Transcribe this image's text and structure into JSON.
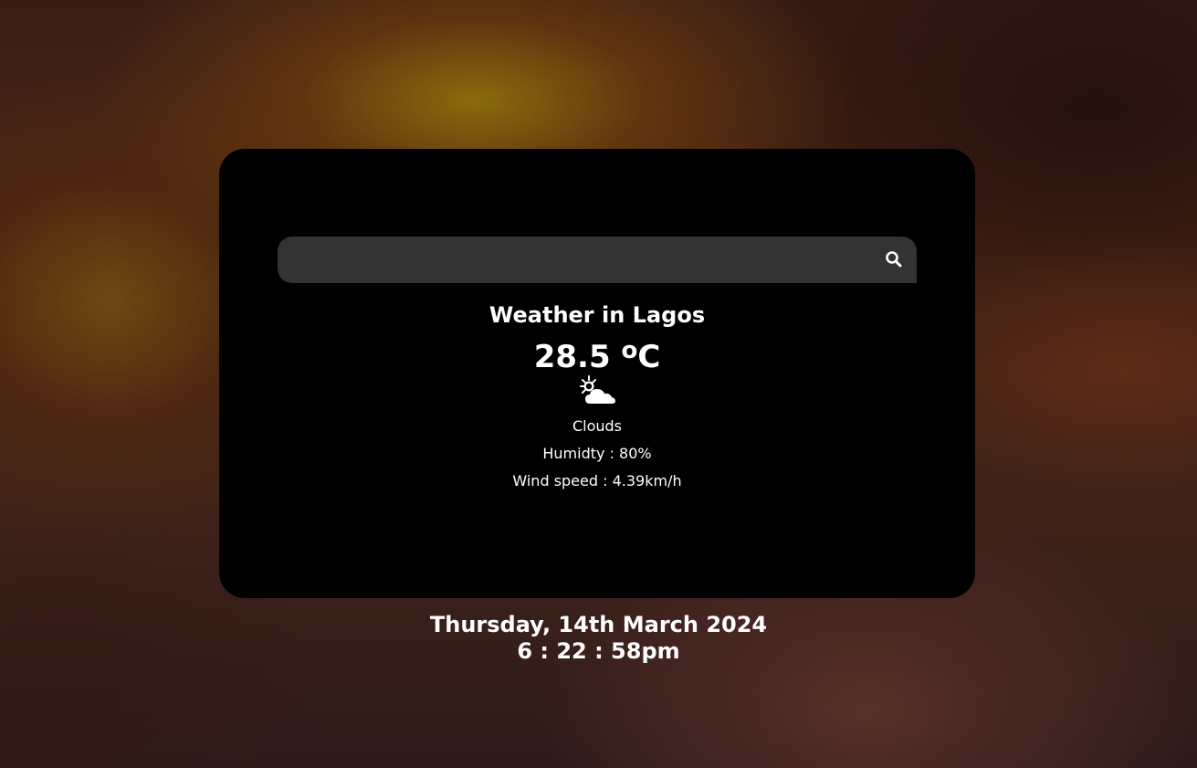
{
  "search": {
    "placeholder": "",
    "value": "",
    "icon": "search-icon"
  },
  "weather": {
    "title": "Weather in Lagos",
    "temperature": "28.5",
    "unit_prefix": "o",
    "unit_suffix": "C",
    "icon": "partly-cloudy-icon",
    "description": "Clouds",
    "humidity": "Humidty : 80%",
    "wind": "Wind speed : 4.39km/h"
  },
  "clock": {
    "date": "Thursday, 14th March 2024",
    "time": "6 : 22 : 58pm"
  },
  "colors": {
    "card": "#000000",
    "search_bg": "#333333",
    "text": "#ffffff"
  }
}
